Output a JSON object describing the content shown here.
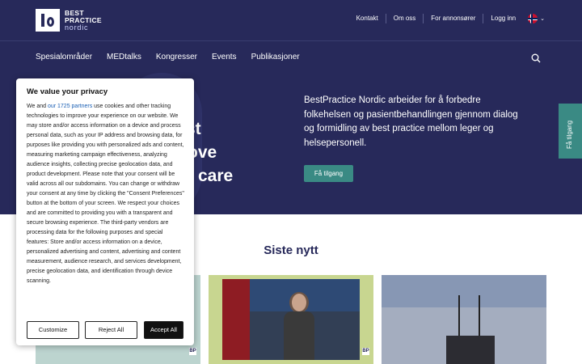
{
  "header": {
    "logo": {
      "line1": "BEST",
      "line2": "PRACTICE",
      "line3": "nordic"
    },
    "top_links": [
      "Kontakt",
      "Om oss",
      "For annonsører",
      "Logg inn"
    ],
    "language_icon": "norway-flag-icon",
    "nav": [
      "Spesialområder",
      "MEDtalks",
      "Kongresser",
      "Events",
      "Publikasjoner"
    ],
    "search_icon": "search-icon"
  },
  "hero": {
    "headline_lines": [
      "st",
      "ove",
      "care"
    ],
    "intro": "BestPractice Nordic arbeider for å forbedre folkehelsen og pasientbehandlingen gjennom dialog og formidling av best practice mellom leger og helsepersonell.",
    "cta_label": "Få tilgang",
    "side_tab_label": "Få tilgang",
    "colors": {
      "background": "#27295a",
      "accent": "#3a8a84"
    }
  },
  "news": {
    "title": "Siste nytt",
    "badge_text": "BP"
  },
  "cookie": {
    "title": "We value your privacy",
    "text_before_link": "We and ",
    "link_text": "our 1725 partners",
    "text_after_link": " use cookies and other tracking technologies to improve your experience on our website. We may store and/or access information on a device and process personal data, such as your IP address and browsing data, for purposes like providing you with personalized ads and content, measuring marketing campaign effectiveness, analyzing audience insights, collecting precise geolocation data, and product development. Please note that your consent will be valid across all our subdomains. You can change or withdraw your consent at any time by clicking the \"Consent Preferences\" button at the bottom of your screen. We respect your choices and are committed to providing you with a transparent and secure browsing experience. The third-party vendors are processing data for the following purposes and special features: Store and/or access information on a device, personalized advertising and content, advertising and content measurement, audience research, and services development, precise geolocation data, and identification through device scanning.",
    "buttons": [
      "Customize",
      "Reject All",
      "Accept All"
    ]
  }
}
